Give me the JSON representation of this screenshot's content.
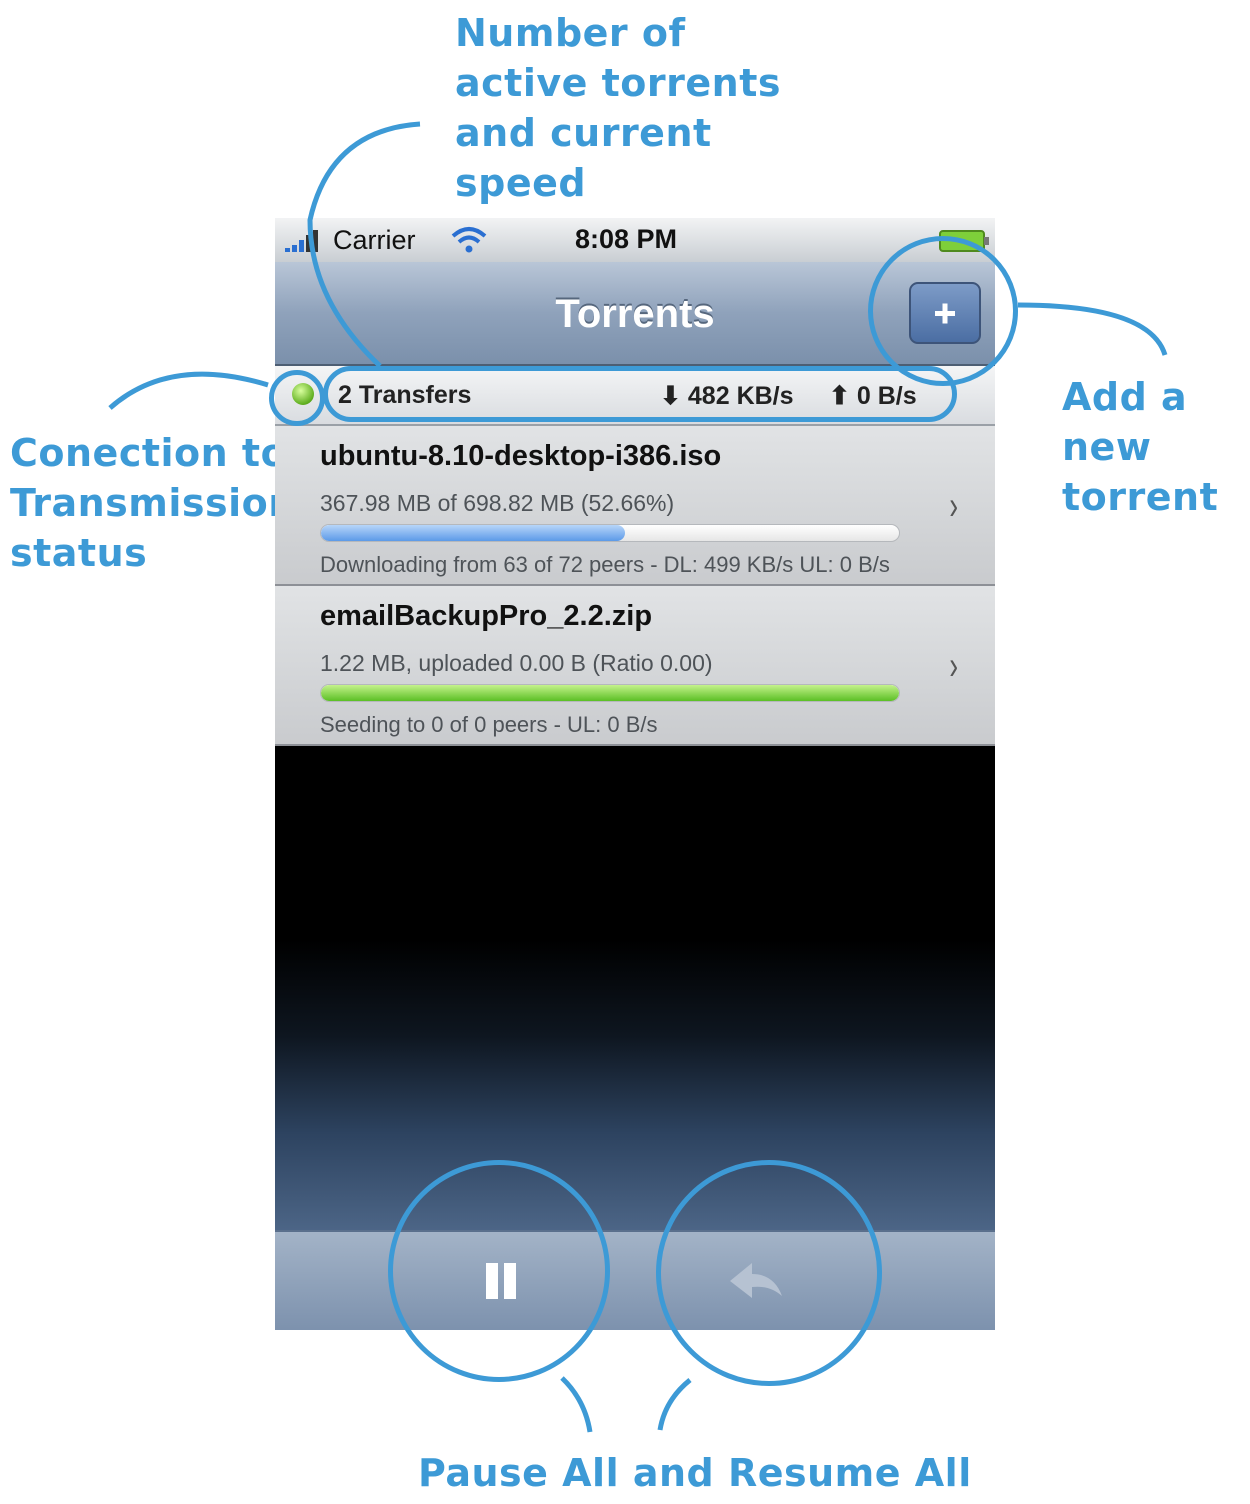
{
  "annotations": {
    "top": [
      "Number of",
      "active torrents",
      "and current",
      "speed"
    ],
    "left": [
      "Conection to",
      "Transmission",
      "status"
    ],
    "right": [
      "Add a new",
      "torrent"
    ],
    "bottom": "Pause All and Resume All"
  },
  "status_bar": {
    "carrier": "Carrier",
    "time": "8:08 PM",
    "icons": [
      "signal-icon",
      "wifi-icon",
      "battery-icon"
    ]
  },
  "nav": {
    "title": "Torrents",
    "add_icon": "plus-icon"
  },
  "summary": {
    "connection_color": "#5fae1f",
    "count_label": "2 Transfers",
    "download_speed": "482 KB/s",
    "upload_speed": "0 B/s"
  },
  "torrents": [
    {
      "name": "ubuntu-8.10-desktop-i386.iso",
      "progress_text": "367.98 MB of 698.82 MB (52.66%)",
      "progress": 0.5266,
      "bar_color": "#5c9ae8",
      "status": "Downloading from 63 of 72 peers - DL: 499 KB/s  UL: 0 B/s"
    },
    {
      "name": "emailBackupPro_2.2.zip",
      "progress_text": "1.22 MB, uploaded 0.00 B (Ratio 0.00)",
      "progress": 1.0,
      "bar_color": "#5bbf25",
      "status": "Seeding to 0 of 0 peers - UL: 0 B/s"
    }
  ],
  "toolbar": {
    "pause_icon": "pause-icon",
    "resume_icon": "resume-icon"
  },
  "colors": {
    "annotation": "#3d9ad6",
    "nav_accent": "#4b6ea3"
  }
}
